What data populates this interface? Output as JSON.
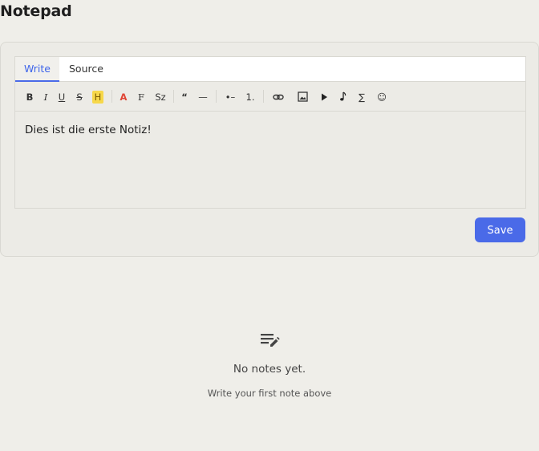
{
  "header": {
    "title": "Notepad"
  },
  "editor": {
    "tabs": [
      {
        "label": "Write",
        "active": true
      },
      {
        "label": "Source",
        "active": false
      }
    ],
    "toolbar": [
      {
        "name": "bold",
        "glyph": "B"
      },
      {
        "name": "italic",
        "glyph": "I"
      },
      {
        "name": "underline",
        "glyph": "U"
      },
      {
        "name": "strikethrough",
        "glyph": "S"
      },
      {
        "name": "highlight",
        "glyph": "H",
        "color": "#f7d84a"
      },
      {
        "name": "text-color",
        "glyph": "A",
        "color": "#e04535"
      },
      {
        "name": "font",
        "glyph": "F"
      },
      {
        "name": "font-size",
        "glyph": "Sz"
      },
      {
        "name": "quote",
        "glyph": "“"
      },
      {
        "name": "horizontal-rule",
        "glyph": "—"
      },
      {
        "name": "bullet-list",
        "glyph": "•–"
      },
      {
        "name": "numbered-list",
        "glyph": "1."
      },
      {
        "name": "link",
        "icon": "link-icon"
      },
      {
        "name": "image",
        "icon": "image-icon"
      },
      {
        "name": "video",
        "icon": "play-icon"
      },
      {
        "name": "audio",
        "icon": "music-note-icon"
      },
      {
        "name": "formula",
        "glyph": "∑"
      },
      {
        "name": "emoji",
        "glyph": "☺"
      }
    ],
    "content": "Dies ist die erste Notiz!",
    "save_label": "Save",
    "accent_color": "#4a6ae8"
  },
  "empty_state": {
    "icon": "notes-edit-icon",
    "title": "No notes yet.",
    "subtitle": "Write your first note above"
  }
}
